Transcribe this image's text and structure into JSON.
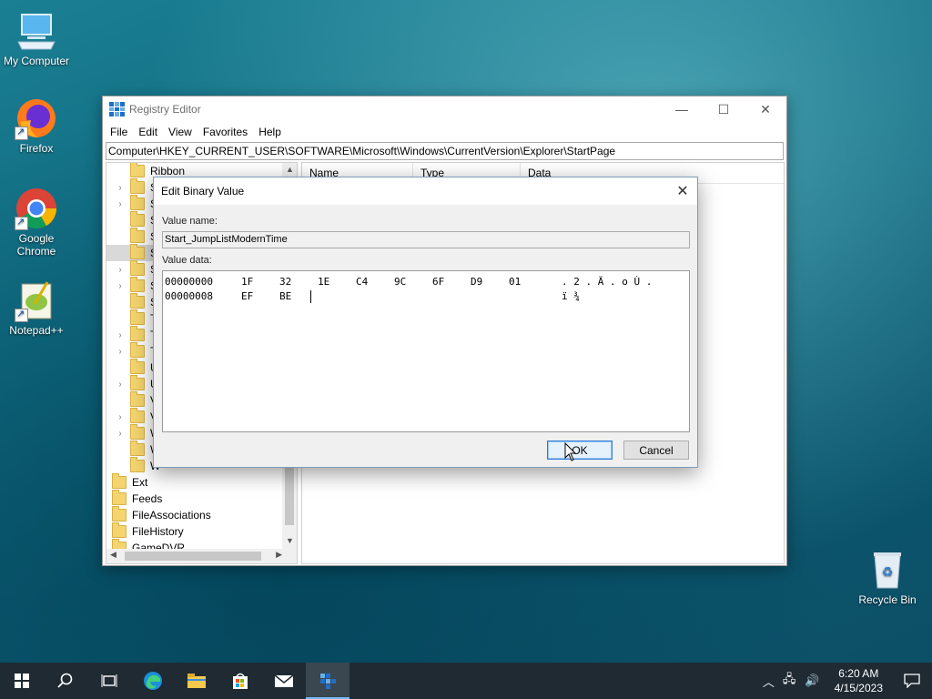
{
  "desktop": {
    "icons": [
      {
        "label": "My Computer"
      },
      {
        "label": "Firefox"
      },
      {
        "label": "Google Chrome"
      },
      {
        "label": "Notepad++"
      },
      {
        "label": "Recycle Bin"
      }
    ]
  },
  "registry_window": {
    "title": "Registry Editor",
    "menu": [
      "File",
      "Edit",
      "View",
      "Favorites",
      "Help"
    ],
    "address": "Computer\\HKEY_CURRENT_USER\\SOFTWARE\\Microsoft\\Windows\\CurrentVersion\\Explorer\\StartPage",
    "tree_items": [
      {
        "label": "Ribbon",
        "expander": ""
      },
      {
        "label": "Se",
        "expander": "›"
      },
      {
        "label": "Se",
        "expander": "›"
      },
      {
        "label": "Sh",
        "expander": ""
      },
      {
        "label": "Sh",
        "expander": ""
      },
      {
        "label": "St",
        "expander": ""
      },
      {
        "label": "St",
        "expander": "›"
      },
      {
        "label": "St",
        "expander": "›"
      },
      {
        "label": "St",
        "expander": ""
      },
      {
        "label": "Ta",
        "expander": ""
      },
      {
        "label": "Ta",
        "expander": "›"
      },
      {
        "label": "TV",
        "expander": "›"
      },
      {
        "label": "Us",
        "expander": ""
      },
      {
        "label": "Us",
        "expander": "›"
      },
      {
        "label": "Vi",
        "expander": ""
      },
      {
        "label": "Vi",
        "expander": "›"
      },
      {
        "label": "W",
        "expander": "›"
      },
      {
        "label": "W",
        "expander": ""
      },
      {
        "label": "W",
        "expander": ""
      },
      {
        "label": "Ext",
        "expander": ""
      },
      {
        "label": "Feeds",
        "expander": ""
      },
      {
        "label": "FileAssociations",
        "expander": ""
      },
      {
        "label": "FileHistory",
        "expander": ""
      },
      {
        "label": "GameDVR",
        "expander": ""
      }
    ],
    "columns": [
      "Name",
      "Type",
      "Data"
    ]
  },
  "dialog": {
    "title": "Edit Binary Value",
    "value_name_label": "Value name:",
    "value_name": "Start_JumpListModernTime",
    "value_data_label": "Value data:",
    "rows": [
      {
        "offset": "00000000",
        "bytes": [
          "1F",
          "32",
          "1E",
          "C4",
          "9C",
          "6F",
          "D9",
          "01"
        ],
        "ascii": ". 2 . Ä . o Ù ."
      },
      {
        "offset": "00000008",
        "bytes": [
          "EF",
          "BE"
        ],
        "ascii": "ï ¾"
      }
    ],
    "ok_label": "OK",
    "cancel_label": "Cancel"
  },
  "taskbar": {
    "time": "6:20 AM",
    "date": "4/15/2023"
  }
}
